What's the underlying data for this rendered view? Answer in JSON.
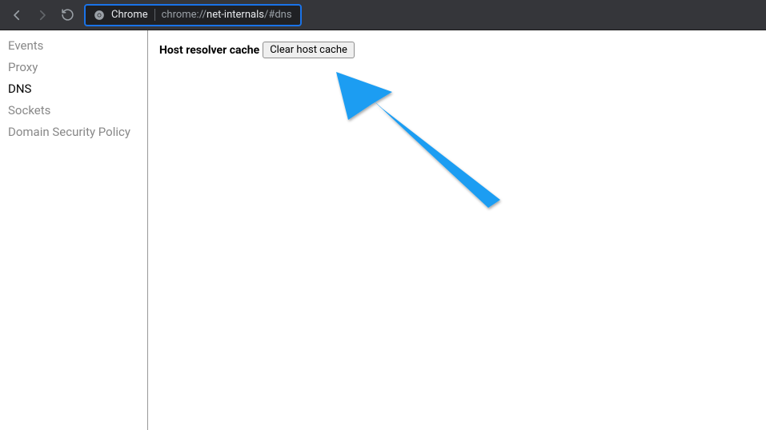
{
  "address_bar": {
    "label": "Chrome",
    "url_prefix": "chrome://",
    "url_bold": "net-internals",
    "url_suffix": "/#dns"
  },
  "sidebar": {
    "items": [
      {
        "label": "Events",
        "active": false
      },
      {
        "label": "Proxy",
        "active": false
      },
      {
        "label": "DNS",
        "active": true
      },
      {
        "label": "Sockets",
        "active": false
      },
      {
        "label": "Domain Security Policy",
        "active": false
      }
    ]
  },
  "main": {
    "resolver_label": "Host resolver cache",
    "clear_button_label": "Clear host cache"
  },
  "annotation": {
    "arrow_color": "#1E9DF2"
  }
}
